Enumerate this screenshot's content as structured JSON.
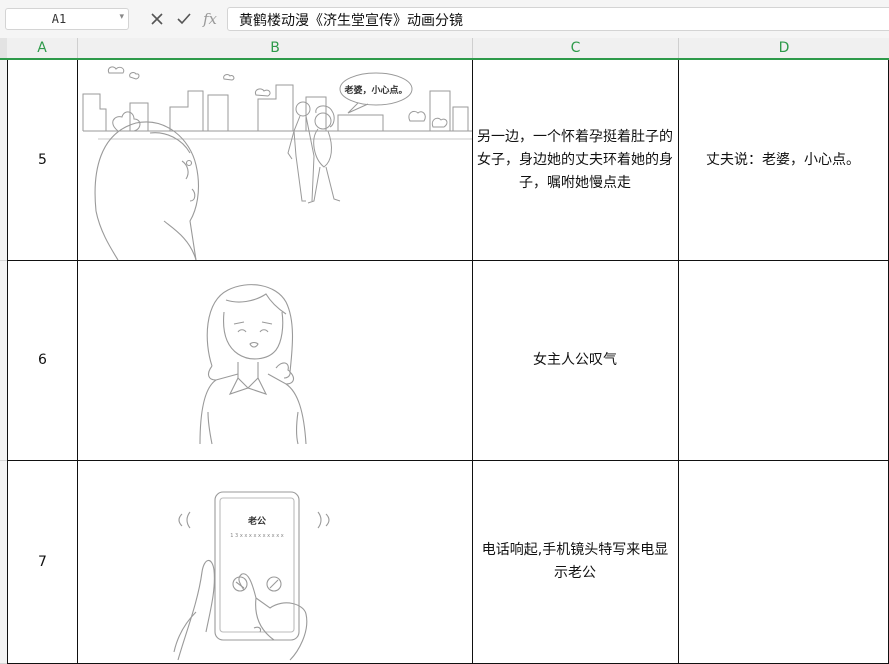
{
  "formula_bar": {
    "cell_reference": "A1",
    "fx_label": "fx",
    "formula_value": "黄鹤楼动漫《济生堂宣传》动画分镜"
  },
  "columns": [
    "A",
    "B",
    "C",
    "D"
  ],
  "rows": [
    {
      "number": "5",
      "description": "另一边，一个怀着孕挺着肚子的女子，身边她的丈夫环着她的身子，嘱咐她慢点走",
      "dialogue": "丈夫说：老婆，小心点。",
      "bubble_text": "老婆，小心点。"
    },
    {
      "number": "6",
      "description": "女主人公叹气",
      "dialogue": ""
    },
    {
      "number": "7",
      "description": "电话响起,手机镜头特写来电显示老公",
      "dialogue": "",
      "phone_caller": "老公",
      "phone_caller_sub": "1 3 x  x x x x x x x x x"
    }
  ]
}
